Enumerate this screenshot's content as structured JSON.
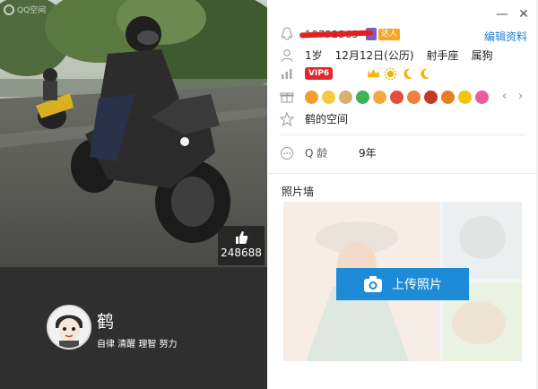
{
  "window": {
    "app_logo_text": "QQ空间",
    "close_glyph": "✕",
    "minimize_glyph": "—"
  },
  "cover": {
    "like_count": "248688"
  },
  "profile": {
    "nickname": "鹤",
    "signature": "自律 清醒 理智 努力"
  },
  "info": {
    "qq_number": "10752365",
    "daren_badge": "达人",
    "edit_label": "编辑资料",
    "age": "1岁",
    "birthday": "12月12日(公历)",
    "zodiac": "射手座",
    "chinese_zodiac": "属狗",
    "vip_label": "VIP6",
    "space_link": "鹤的空间",
    "q_age_label": "Q 龄",
    "q_age_value": "9年",
    "photo_wall_label": "照片墙",
    "upload_label": "上传照片",
    "arrow_left": "‹",
    "arrow_right": "›"
  },
  "colors": {
    "accent": "#1e8bd9",
    "link": "#1a7fd6",
    "vip_red": "#e2262e",
    "profile_bg": "#2f2f2f"
  },
  "icons": {
    "level": [
      "crown-icon",
      "sun-icon",
      "moon-icon",
      "moon-icon"
    ],
    "pets": [
      "#f0a030",
      "#f5c842",
      "#ff8a3d",
      "#3cb35a",
      "#f4a940",
      "#e44b3b",
      "#f0803c",
      "#c0392b",
      "#e67e22",
      "#f1c40f",
      "#e85d9a"
    ]
  }
}
